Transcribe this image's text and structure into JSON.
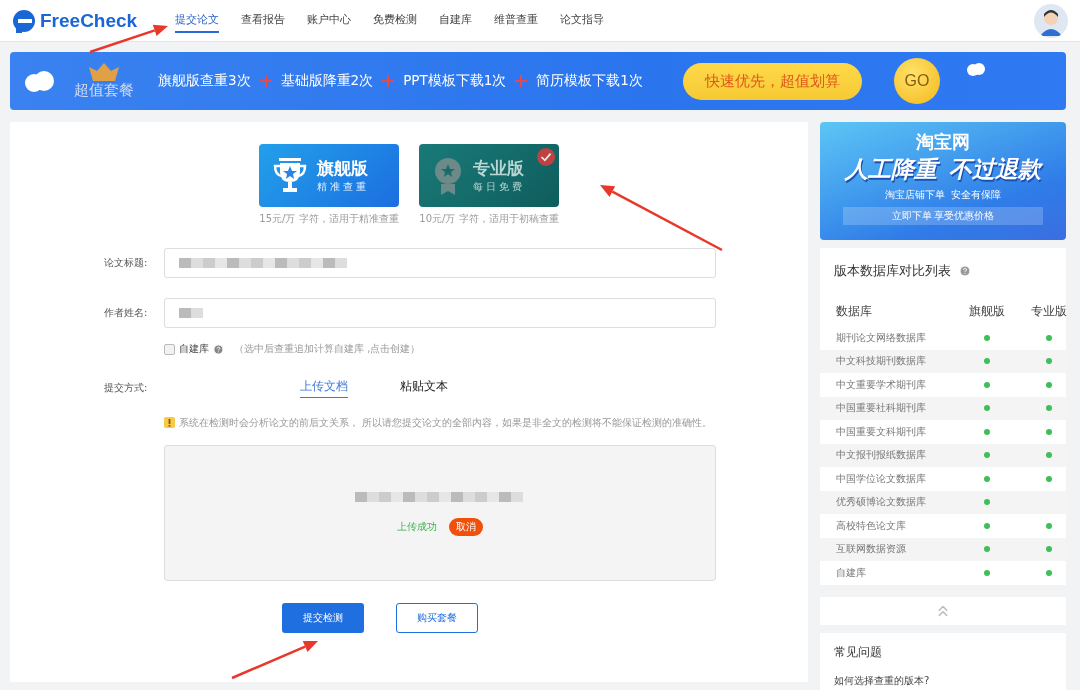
{
  "header": {
    "logo": "FreeCheck",
    "nav": [
      {
        "label": "提交论文",
        "selected": true
      },
      {
        "label": "查看报告",
        "selected": false
      },
      {
        "label": "账户中心",
        "selected": false
      },
      {
        "label": "免费检测",
        "selected": false
      },
      {
        "label": "自建库",
        "selected": false
      },
      {
        "label": "维普查重",
        "selected": false
      },
      {
        "label": "论文指导",
        "selected": false
      }
    ]
  },
  "banner": {
    "title": "超值套餐",
    "items": [
      "旗舰版查重3次",
      "基础版降重2次",
      "PPT模板下载1次",
      "简历模板下载1次"
    ],
    "promo": "快速优先，超值划算",
    "go": "GO"
  },
  "versions": [
    {
      "kind": "trophy",
      "name": "旗舰版",
      "tagline": "精准查重",
      "price": "15元/万 字符，适用于精准查重",
      "selected": false
    },
    {
      "kind": "medal",
      "name": "专业版",
      "tagline": "每日免费",
      "price": "10元/万 字符，适用于初稿查重",
      "selected": true
    }
  ],
  "form": {
    "title_label": "论文标题:",
    "author_label": "作者姓名:",
    "custom_db": {
      "label": "自建库",
      "checked": false,
      "hint": "（选中后查重追加计算自建库 ,点击创建）"
    },
    "method_label": "提交方式:",
    "methods": [
      {
        "label": "上传文档",
        "selected": true
      },
      {
        "label": "粘贴文本",
        "selected": false
      }
    ],
    "warning": "系统在检测时会分析论文的前后文关系， 所以请您提交论文的全部内容，如果是非全文的检测将不能保证检测的准确性。",
    "upload": {
      "status": "上传成功",
      "cancel": "取消"
    },
    "submit": "提交检测",
    "buy": "购买套餐"
  },
  "ad": {
    "brand": "淘宝网",
    "headline_1": "人工降重",
    "headline_2": "不过退款",
    "sub": "淘宝店铺下单  安全有保障",
    "cta": "立即下单 享受优惠价格"
  },
  "compare": {
    "title": "版本数据库对比列表",
    "columns": [
      "数据库",
      "旗舰版",
      "专业版"
    ],
    "rows": [
      {
        "name": "期刊论文网络数据库",
        "flagship": true,
        "pro": true
      },
      {
        "name": "中文科技期刊数据库",
        "flagship": true,
        "pro": true
      },
      {
        "name": "中文重要学术期刊库",
        "flagship": true,
        "pro": true
      },
      {
        "name": "中国重要社科期刊库",
        "flagship": true,
        "pro": true
      },
      {
        "name": "中国重要文科期刊库",
        "flagship": true,
        "pro": true
      },
      {
        "name": "中文报刊报纸数据库",
        "flagship": true,
        "pro": true
      },
      {
        "name": "中国学位论文数据库",
        "flagship": true,
        "pro": true
      },
      {
        "name": "优秀硕博论文数据库",
        "flagship": true,
        "pro": false
      },
      {
        "name": "高校特色论文库",
        "flagship": true,
        "pro": true
      },
      {
        "name": "互联网数据资源",
        "flagship": true,
        "pro": true
      },
      {
        "name": "自建库",
        "flagship": true,
        "pro": true
      }
    ]
  },
  "faq": {
    "title": "常见问题",
    "items": [
      "如何选择查重的版本?"
    ]
  }
}
